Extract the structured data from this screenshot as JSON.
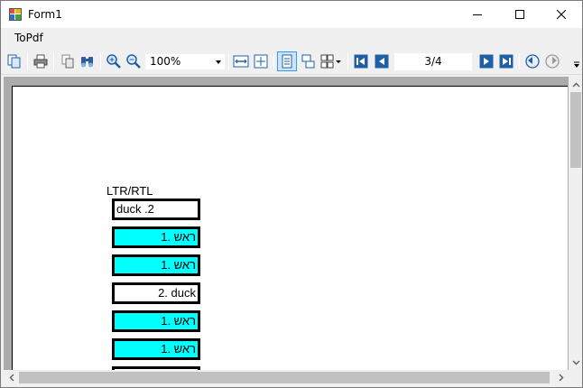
{
  "window": {
    "title": "Form1",
    "minimize_icon": "minimize-icon",
    "maximize_icon": "maximize-icon",
    "close_icon": "close-icon"
  },
  "menu": {
    "items": [
      {
        "label": "ToPdf"
      }
    ]
  },
  "toolbar": {
    "zoom_value": "100%",
    "page_indicator": "3/4",
    "buttons": [
      "copy-icon",
      "print-icon",
      "copy-pages-icon",
      "find-icon",
      "zoom-in-icon",
      "zoom-out-icon",
      "page-width-icon",
      "whole-page-icon",
      "single-page-icon",
      "continuous-icon",
      "multi-page-icon",
      "first-page-icon",
      "previous-page-icon",
      "next-page-icon",
      "last-page-icon",
      "back-icon",
      "forward-icon"
    ]
  },
  "report": {
    "label": "LTR/RTL",
    "cells": [
      {
        "text": "duck .2",
        "style": "white"
      },
      {
        "text": "ראש .1",
        "style": "cyan"
      },
      {
        "text": "ראש .1",
        "style": "cyan"
      },
      {
        "text": "2. duck",
        "style": "white"
      },
      {
        "text": "ראש .1",
        "style": "cyan"
      },
      {
        "text": "ראש .1",
        "style": "cyan"
      }
    ]
  },
  "colors": {
    "cyan_fill": "#00ffff",
    "preview_background": "#ababab",
    "active_button": "#cce4f7"
  }
}
